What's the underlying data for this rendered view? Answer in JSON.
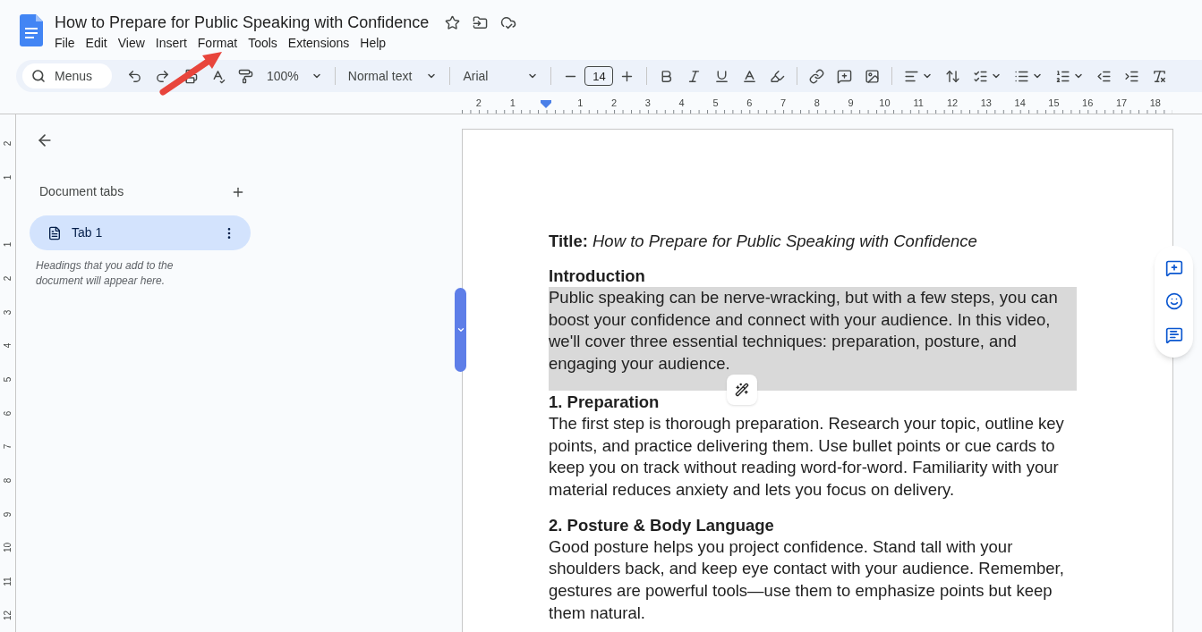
{
  "document_title": "How to Prepare for Public Speaking with Confidence",
  "menu": [
    "File",
    "Edit",
    "View",
    "Insert",
    "Format",
    "Tools",
    "Extensions",
    "Help"
  ],
  "toolbar": {
    "search": {
      "placeholder": "Menus"
    },
    "zoom": "100%",
    "paragraph_style": "Normal text",
    "font": "Arial",
    "font_size": "14"
  },
  "ruler": {
    "horizontal_labels": [
      "2",
      "1",
      "1",
      "2",
      "3",
      "4",
      "5",
      "6",
      "7",
      "8",
      "9",
      "10",
      "11",
      "12",
      "13",
      "14",
      "15",
      "16",
      "17",
      "18"
    ],
    "vertical_labels": [
      "2",
      "1",
      "1",
      "2",
      "3",
      "4",
      "5",
      "6",
      "7",
      "8",
      "9",
      "10",
      "11",
      "12"
    ]
  },
  "sidebar": {
    "heading": "Document tabs",
    "tabs": [
      {
        "label": "Tab 1",
        "selected": true
      }
    ],
    "hint": "Headings that you add to the document will appear here."
  },
  "document": {
    "title_line": "**Title:** *How to Prepare for Public Speaking with Confidence*",
    "sections": [
      {
        "heading": "Introduction",
        "paragraph": "Public speaking can be nerve-wracking, but with a few steps, you can boost your confidence and connect with your audience. In this video, we'll cover three essential techniques: preparation, posture, and engaging your audience.",
        "selected": true
      },
      {
        "heading": "1. Preparation",
        "paragraph": "The first step is thorough preparation. Research your topic, outline key points, and practice delivering them. Use bullet points or cue cards to keep you on track without reading word-for-word. Familiarity with your material reduces anxiety and lets you focus on delivery.",
        "selected": false
      },
      {
        "heading": "2. Posture & Body Language",
        "paragraph": "Good posture helps you project confidence. Stand tall with your shoulders back, and keep eye contact with your audience. Remember, gestures are powerful tools—use them to emphasize points but keep them natural.",
        "selected": false
      }
    ]
  }
}
